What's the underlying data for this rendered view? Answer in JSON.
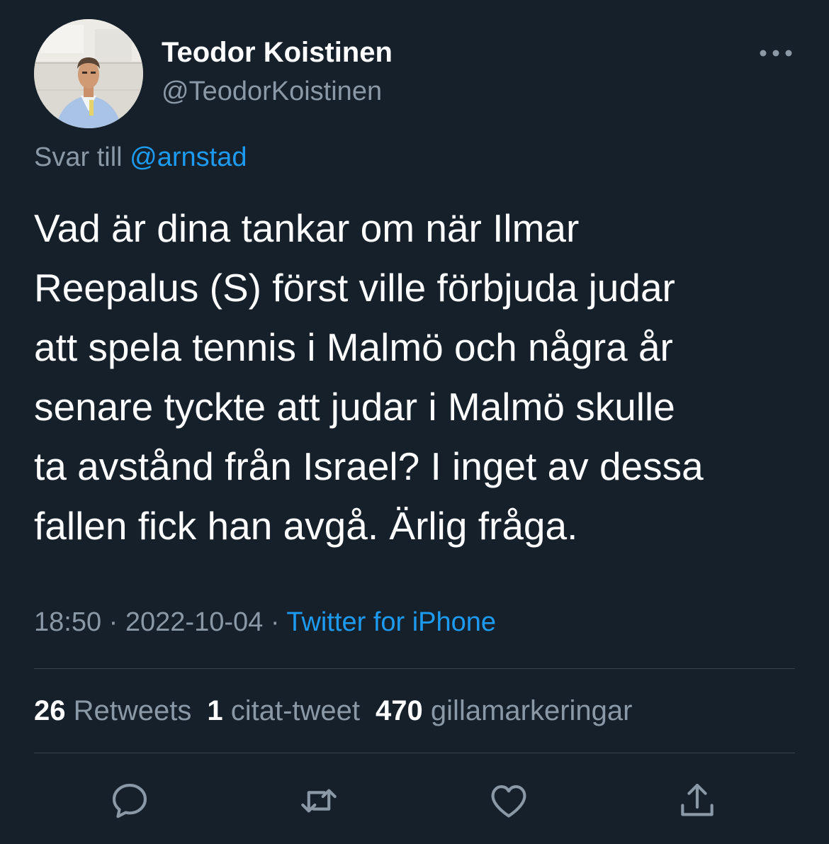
{
  "author": {
    "display_name": "Teodor Koistinen",
    "handle": "@TeodorKoistinen"
  },
  "reply": {
    "prefix": "Svar till",
    "mention": "@arnstad"
  },
  "tweet": {
    "text": "Vad är dina tankar om när Ilmar\nReepalus (S) först ville förbjuda judar\natt spela tennis i Malmö och några år\nsenare tyckte att judar i Malmö skulle\nta avstånd från Israel? I inget av dessa\nfallen fick han avgå. Ärlig fråga."
  },
  "meta": {
    "time": "18:50",
    "separator": "·",
    "date": "2022-10-04",
    "source": "Twitter for iPhone"
  },
  "stats": {
    "retweets_count": "26",
    "retweets_label": "Retweets",
    "quotes_count": "1",
    "quotes_label": "citat-tweet",
    "likes_count": "470",
    "likes_label": "gillamarkeringar"
  },
  "icons": {
    "more": "more-horizontal-icon",
    "reply": "reply-icon",
    "retweet": "retweet-icon",
    "like": "heart-icon",
    "share": "share-icon"
  },
  "colors": {
    "background": "#15202b",
    "accent": "#1d9bf0",
    "secondary_text": "#8b98a5",
    "divider": "#38444d"
  }
}
